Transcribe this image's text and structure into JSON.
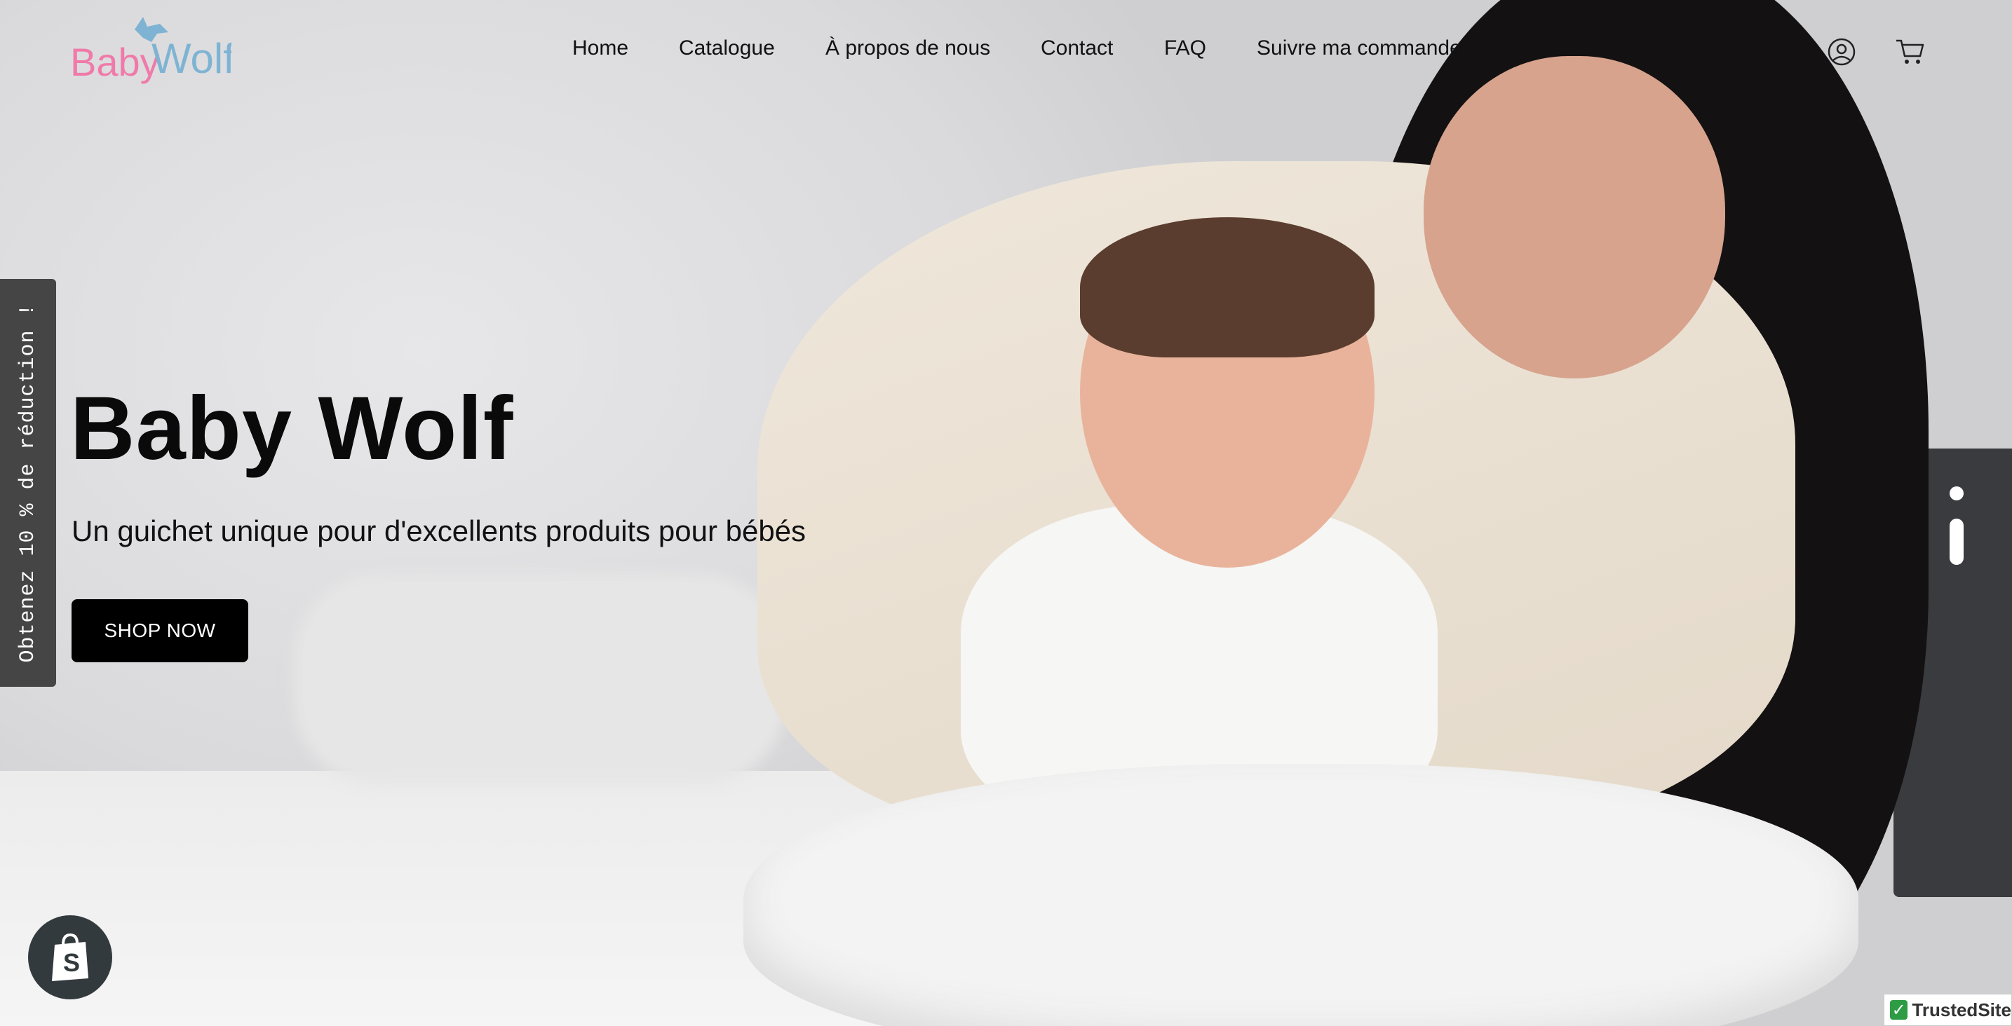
{
  "header": {
    "logo_text_baby": "Baby",
    "logo_text_wolf": "Wolf",
    "nav": [
      "Home",
      "Catalogue",
      "À propos de nous",
      "Contact",
      "FAQ",
      "Suivre ma commande"
    ],
    "icons": [
      "account-icon",
      "cart-icon"
    ]
  },
  "hero": {
    "title": "Baby Wolf",
    "subtitle": "Un guichet unique pour d'excellents produits pour bébés",
    "cta": "SHOP NOW",
    "slides_total": 2,
    "active_slide": 2
  },
  "side_tab": {
    "label": "Obtenez 10 % de réduction !"
  },
  "badges": {
    "trusted_site": "TrustedSite",
    "shopify_icon": "shopify-bag-icon"
  },
  "colors": {
    "logo_pink": "#f07aa9",
    "logo_blue": "#7fb3d3",
    "button_bg": "#000000",
    "side_tab_bg": "#454545",
    "trusted_green": "#2e9c45"
  }
}
